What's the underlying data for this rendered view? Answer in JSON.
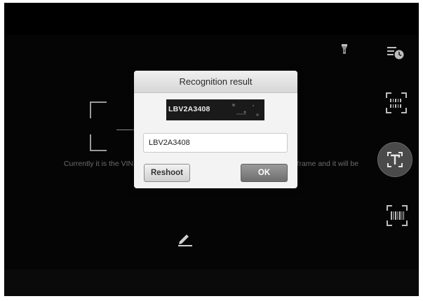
{
  "scanner": {
    "hint_text": "Currently it is the VIN recognition mode, please align the VIN within the frame and it will be recognized automatically"
  },
  "toolbar": {
    "torch_icon": "flashlight-icon",
    "history_icon": "history-icon",
    "vin_mode_icon": "vin-scan-icon",
    "text_mode_icon": "text-recognition-icon",
    "barcode_mode_icon": "barcode-scan-icon",
    "edit_icon": "pencil-icon"
  },
  "dialog": {
    "title": "Recognition result",
    "vin_image_text": "LBV2A3408",
    "vin_value": "LBV2A3408",
    "reshoot_label": "Reshoot",
    "ok_label": "OK"
  },
  "colors": {
    "background": "#050505",
    "dialog_bg": "#f3f3f3",
    "ok_button": "#7e7e7e",
    "active_mode": "#4a4a4a"
  }
}
